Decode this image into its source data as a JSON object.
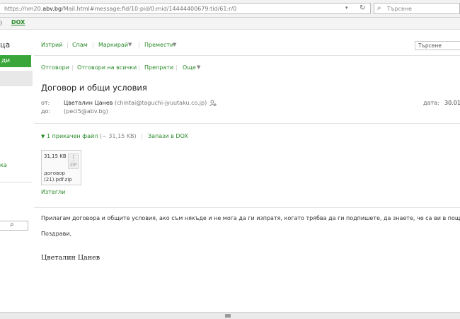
{
  "browser": {
    "url_prefix": "https://nm20.",
    "url_domain": "abv.bg",
    "url_suffix": "/Mail.html#message:fid/10:pid/0:mid/14444400679:tid/61:r/0",
    "search_placeholder": "Търсене",
    "dropdown_icon": "chevron-down",
    "reload_icon": "reload"
  },
  "topstrip": {
    "left_fragment": ")",
    "dox_label": "DOX"
  },
  "left": {
    "title_fragment": "ца",
    "button_fragment": "ди",
    "link_fragment": "ка"
  },
  "toolbar1": {
    "items": [
      "Изтрий",
      "Спам",
      "Маркирай",
      "Премести"
    ],
    "search_placeholder": "Търсене"
  },
  "toolbar2": {
    "items": [
      "Отговори",
      "Отговори на всички",
      "Препрати",
      "Още"
    ]
  },
  "message": {
    "subject": "Договор и общи условия",
    "from_label": "от:",
    "from_name": "Цветалин Цанев",
    "from_email": "(chintai@taguchi-jyuutaku.co.jp)",
    "to_label": "до:",
    "to_email": "(peci5@abv.bg)",
    "date_label": "дата:",
    "date_value": "30.01"
  },
  "attachments": {
    "count_label": "1 прикачен файл",
    "size_label": "(~ 31,15 KB)",
    "save_dox_label": "Запази в DOX",
    "file_size": "31,15 KB",
    "file_type": "ZIP",
    "file_name": "договор (21).pdf.zip",
    "download_label": "Изтегли"
  },
  "body": {
    "text": "Прилагам договора и общите условия, ако съм някъде и не мога да ги изпратя, когато трябва да ги подпишете, да знаете, че са ви в пощата.",
    "greeting": "Поздрави,",
    "signature": "Цветалин Цанев"
  },
  "colors": {
    "accent_green": "#2b8a2b",
    "button_green": "#3aa63a"
  }
}
